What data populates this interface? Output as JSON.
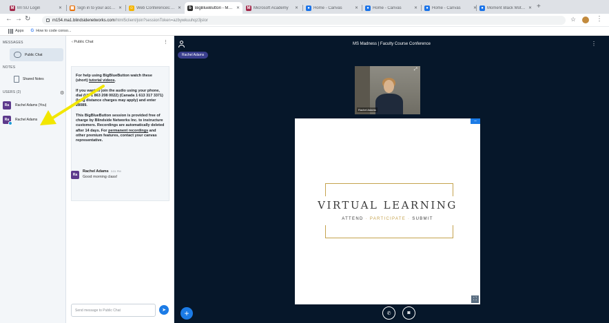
{
  "browser": {
    "tabs": [
      {
        "label": "MTSU Login",
        "fav": "M",
        "fav_color": "#a3284a"
      },
      {
        "label": "Sign in to your account",
        "fav": "▦",
        "fav_color": "#e8710a"
      },
      {
        "label": "Web Conferences: MT",
        "fav": "☺",
        "fav_color": "#f4b400"
      },
      {
        "label": "BigBlueButton - MS M",
        "fav": "b",
        "fav_color": "#2b2b2b"
      },
      {
        "label": "Microsoft Academy",
        "fav": "M",
        "fav_color": "#a3284a"
      },
      {
        "label": "Home - Canvas",
        "fav": "●",
        "fav_color": "#1a73e8"
      },
      {
        "label": "Home - Canvas",
        "fav": "●",
        "fav_color": "#1a73e8"
      },
      {
        "label": "Home - Canvas",
        "fav": "●",
        "fav_color": "#1a73e8"
      },
      {
        "label": "Moment Black Motion",
        "fav": "●",
        "fav_color": "#1a73e8"
      }
    ],
    "url_host": "m154.ma1.blindsidenetworks.com",
    "url_path": "/html5client/join?sessionToken=azbywkuuhqz3jslor",
    "bookmarks": [
      {
        "label": "Apps",
        "icon": "apps-icon"
      },
      {
        "label": "How to code conso...",
        "icon": "google-icon"
      }
    ]
  },
  "left_panel": {
    "messages_header": "MESSAGES",
    "public_chat": "Public Chat",
    "notes_header": "NOTES",
    "shared_notes": "Shared Notes",
    "users_header": "USERS (2)",
    "users": [
      {
        "initials": "Ra",
        "name": "Rachel Adams (You)"
      },
      {
        "initials": "Ra",
        "name": "Rachel Adams"
      }
    ]
  },
  "chat": {
    "header": "‹  Public Chat",
    "welcome_1a": "For help using BigBlueButton watch these (short) ",
    "welcome_1b": "tutorial videos",
    "welcome_1c": ".",
    "welcome_2": "If you want to join the audio using your phone, dial (US 1 863 208 0022) (Canada 1 613 317 3371) (long distance charges may apply) and enter 28089.",
    "welcome_3a": "This BigBlueButton session is provided free of charge by Blindside Networks Inc. to instructure customers. Recordings are automatically deleted after 14 days. For ",
    "welcome_3b": "permanent recordings",
    "welcome_3c": " and other premium features, contact your canvas representative.",
    "message": {
      "initials": "Ra",
      "name": "Rachel Adams",
      "time": "3:31 PM",
      "text": "Good morning class!"
    },
    "input_placeholder": "Send message to Public Chat"
  },
  "main": {
    "session_title": "MS Madness | Faculty Course Conference",
    "talking_pill": "Rachel Adams",
    "webcam_name": "Rachel Adams",
    "slide": {
      "title": "VIRTUAL LEARNING",
      "sub_1": "ATTEND",
      "sub_sep": "·",
      "sub_2": "PARTICIPATE",
      "sub_3": "SUBMIT",
      "accent_color": "#c4a24c"
    }
  }
}
